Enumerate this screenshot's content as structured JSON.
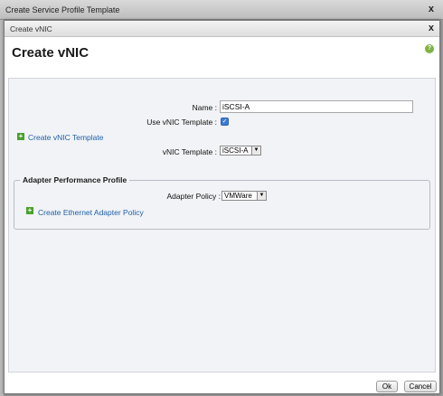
{
  "outer_window": {
    "title": "Create Service Profile Template",
    "close_glyph": "x"
  },
  "dialog": {
    "window_title": "Create vNIC",
    "close_glyph": "x",
    "heading": "Create vNIC",
    "help_glyph": "?"
  },
  "form": {
    "name_label": "Name :",
    "name_value": "iSCSI-A",
    "use_template_label": "Use vNIC Template :",
    "use_template_checked": true,
    "create_template_link": "Create vNIC Template",
    "template_label": "vNIC Template :",
    "template_value": "iSCSI-A"
  },
  "adapter_section": {
    "title": "Adapter Performance Profile",
    "policy_label": "Adapter Policy :",
    "policy_value": "VMWare",
    "create_policy_link": "Create Ethernet Adapter Policy"
  },
  "buttons": {
    "ok": "Ok",
    "cancel": "Cancel"
  },
  "colors": {
    "link": "#2160a8",
    "plus_icon": "#4aa02c",
    "checkbox": "#3d7bd6",
    "panel_bg": "#f1f3f6"
  }
}
